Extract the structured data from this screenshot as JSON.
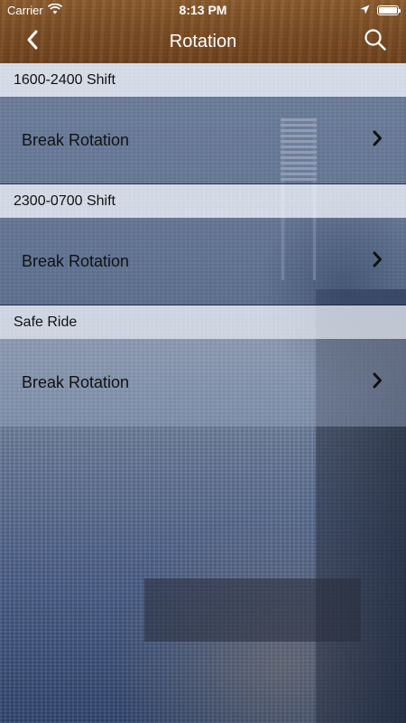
{
  "status_bar": {
    "carrier": "Carrier",
    "time": "8:13 PM",
    "battery_level": 1.0
  },
  "nav": {
    "title": "Rotation",
    "back_icon": "chevron-left-icon",
    "search_icon": "search-icon"
  },
  "sections": [
    {
      "header": "1600-2400 Shift",
      "row_label": "Break Rotation"
    },
    {
      "header": "2300-0700 Shift",
      "row_label": "Break Rotation"
    },
    {
      "header": "Safe Ride",
      "row_label": "Break Rotation"
    }
  ],
  "colors": {
    "nav_wood": "#7a4b22",
    "row_overlay": "#3c5278",
    "header_overlay": "#dee4ee"
  }
}
